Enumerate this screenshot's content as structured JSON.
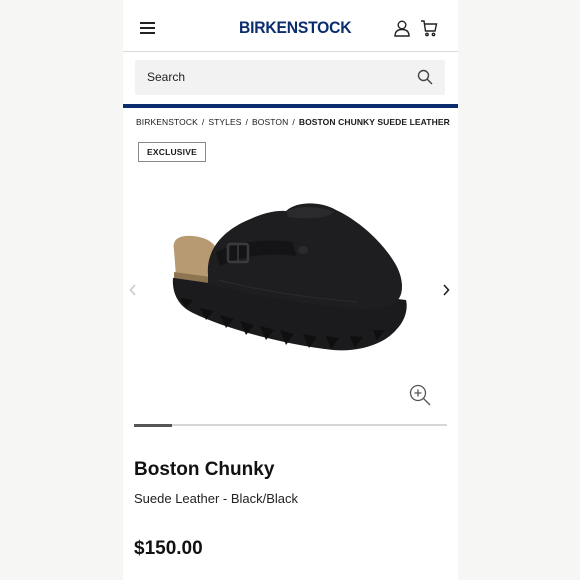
{
  "header": {
    "logo_text": "BIRKENSTOCK",
    "logo_color": "#0a2d6e",
    "menu_icon": "hamburger-menu-icon",
    "account_icon": "user-icon",
    "cart_icon": "shopping-cart-icon"
  },
  "search": {
    "placeholder": "Search",
    "icon": "search-icon"
  },
  "breadcrumb": {
    "items": [
      "BIRKENSTOCK",
      "STYLES",
      "BOSTON"
    ],
    "current": "BOSTON CHUNKY SUEDE LEATHER",
    "separator": "/"
  },
  "product": {
    "badge": "EXCLUSIVE",
    "name": "Boston Chunky",
    "variant": "Suede Leather - Black/Black",
    "price": "$150.00",
    "image_alt": "black suede clog with chunky sole",
    "carousel_progress": 0.12
  },
  "colors": {
    "accent": "#0a2d6e",
    "text": "#1a1a1a"
  }
}
